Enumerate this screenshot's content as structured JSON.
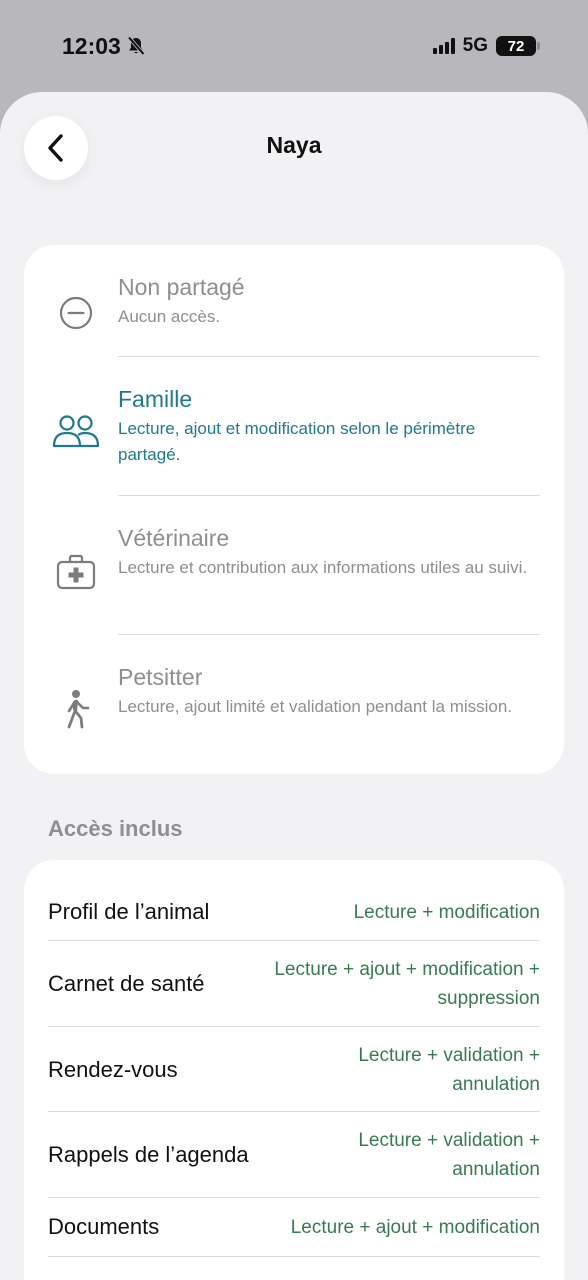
{
  "status_bar": {
    "time": "12:03",
    "network": "5G",
    "battery": "72"
  },
  "nav": {
    "title": "Naya"
  },
  "sharing_options": [
    {
      "title": "Non partagé",
      "description": "Aucun accès.",
      "icon": "minus-circle-icon",
      "selected": false
    },
    {
      "title": "Famille",
      "description": "Lecture, ajout et modification selon le périmètre partagé.",
      "icon": "people-icon",
      "selected": true
    },
    {
      "title": "Vétérinaire",
      "description": "Lecture et contribution aux informations utiles au suivi.",
      "icon": "medical-case-icon",
      "selected": false
    },
    {
      "title": "Petsitter",
      "description": "Lecture, ajout limité et validation pendant la mission.",
      "icon": "walking-person-icon",
      "selected": false
    }
  ],
  "included_access": {
    "title": "Accès inclus",
    "rows": [
      {
        "label": "Profil de l’animal",
        "value": "Lecture + modification"
      },
      {
        "label": "Carnet de santé",
        "value": "Lecture + ajout + modification + suppression"
      },
      {
        "label": "Rendez-vous",
        "value": "Lecture + validation + annulation"
      },
      {
        "label": "Rappels de l’agenda",
        "value": "Lecture + validation + annulation"
      },
      {
        "label": "Documents",
        "value": "Lecture + ajout + modification"
      }
    ]
  },
  "colors": {
    "accent": "#1e7a8c",
    "access_value": "#3a7a52",
    "muted": "#8e8e93",
    "background": "#f2f2f4"
  }
}
